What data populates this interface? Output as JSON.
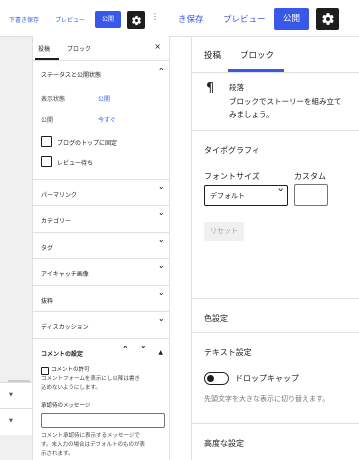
{
  "toolbar": {
    "save_draft": "下書き保存",
    "preview": "プレビュー",
    "publish": "公開",
    "settings_icon": "gear-icon",
    "more_icon": "more-vertical-icon"
  },
  "sidebar": {
    "tabs": [
      "投稿",
      "ブロック"
    ],
    "close": "×",
    "status": {
      "title": "ステータスと公開状態",
      "visibility_label": "表示状態",
      "visibility_value": "公開",
      "publish_label": "公開",
      "publish_value": "今すぐ",
      "sticky_label": "ブログのトップに固定",
      "review_label": "レビュー待ち"
    },
    "sections": [
      "パーマリンク",
      "カテゴリー",
      "タグ",
      "アイキャッチ画像",
      "抜粋",
      "ディスカッション"
    ],
    "comment_settings": {
      "title": "コメントの設定",
      "enable_label": "コメントの許可",
      "enable_help_1": "コメントフォームを表示にし以降は書き",
      "enable_help_2": "込めないようにします。",
      "message_label": "承認待のメッセージ",
      "message_help_1": "コメント承認待に表示するメッセージで",
      "message_help_2": "す。未入力の場合はデフォルトのものが表",
      "message_help_3": "示されます。"
    }
  },
  "right": {
    "toolbar": {
      "save_draft": "き保存",
      "preview": "プレビュー",
      "publish": "公開"
    },
    "tabs": [
      "投稿",
      "ブロック"
    ],
    "block": {
      "icon": "¶",
      "name": "段落",
      "desc_1": "ブロックでストーリーを組み立て",
      "desc_2": "みましょう。"
    },
    "typography": {
      "title": "タイポグラフィ",
      "font_size_label": "フォントサイズ",
      "custom_label": "カスタム",
      "select_value": "デフォルト",
      "reset": "リセット"
    },
    "color_title": "色設定",
    "text_settings": {
      "title": "テキスト設定",
      "drop_cap_label": "ドロップキャップ",
      "drop_cap_help": "先頭文字を大きな表示に切り替えます。"
    },
    "advanced_title": "高度な設定"
  }
}
